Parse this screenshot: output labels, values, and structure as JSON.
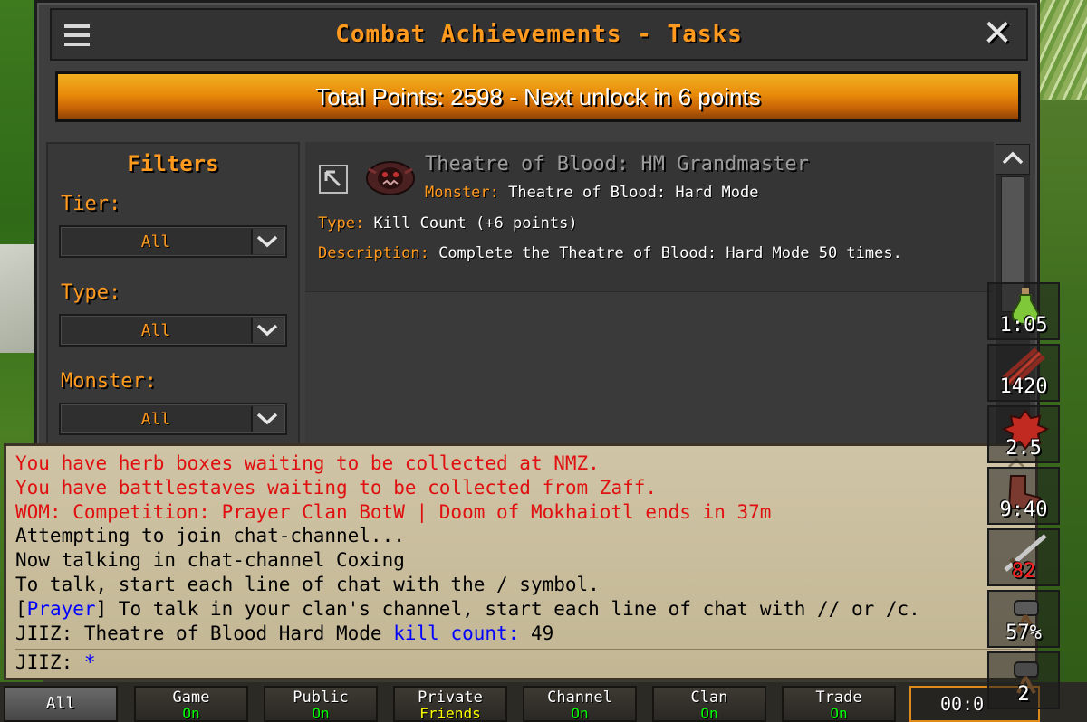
{
  "window": {
    "title": "Combat Achievements - Tasks",
    "total_points": "Total Points: 2598 - Next unlock in 6 points"
  },
  "filters": {
    "heading": "Filters",
    "items": [
      {
        "label": "Tier:",
        "value": "All"
      },
      {
        "label": "Type:",
        "value": "All"
      },
      {
        "label": "Monster:",
        "value": "All"
      }
    ]
  },
  "task": {
    "name": "Theatre of Blood: HM Grandmaster",
    "monster_key": "Monster:",
    "monster_value": "Theatre of Blood: Hard Mode",
    "type_key": "Type:",
    "type_value": "Kill Count (+6 points)",
    "description_key": "Description:",
    "description_value": "Complete the Theatre of Blood: Hard Mode 50 times."
  },
  "chat": {
    "lines": [
      {
        "text": "You have herb boxes waiting to be collected at NMZ.",
        "color": "#e01010"
      },
      {
        "text": "You have battlestaves waiting to be collected from Zaff.",
        "color": "#e01010"
      },
      {
        "text": "WOM: Competition: Prayer Clan BotW | Doom of Mokhaiotl ends in 37m",
        "color": "#e01010"
      },
      {
        "text": "Attempting to join chat-channel...",
        "color": "#000000"
      },
      {
        "text": "Now talking in chat-channel Coxing",
        "color": "#000000"
      },
      {
        "text": "To talk, start each line of chat with the / symbol.",
        "color": "#000000"
      }
    ],
    "clan_line": {
      "open": "[",
      "clan": "Prayer",
      "rest": "] To talk in your clan's channel, start each line of chat with // or /c."
    },
    "kc_line": {
      "prefix": "JIIZ: Theatre of Blood Hard Mode ",
      "kc_label": "kill count:",
      "kc_value": " 49"
    },
    "input": {
      "prefix": "JIIZ: ",
      "cursor": "*"
    }
  },
  "tabs": [
    {
      "label": "All",
      "status": "",
      "status_color": ""
    },
    {
      "label": "Game",
      "status": "On",
      "status_color": "#00ff00"
    },
    {
      "label": "Public",
      "status": "On",
      "status_color": "#00ff00"
    },
    {
      "label": "Private",
      "status": "Friends",
      "status_color": "#ffff00"
    },
    {
      "label": "Channel",
      "status": "On",
      "status_color": "#00ff00"
    },
    {
      "label": "Clan",
      "status": "On",
      "status_color": "#00ff00"
    },
    {
      "label": "Trade",
      "status": "On",
      "status_color": "#00ff00"
    }
  ],
  "timer": "00:0",
  "boosts": [
    {
      "icon": "potion-icon",
      "value": "1:05",
      "color": "#ffffff"
    },
    {
      "icon": "arrows-icon",
      "value": "1420",
      "color": "#ffffff"
    },
    {
      "icon": "spiked-shield-icon",
      "value": "2.5",
      "color": "#ffffff"
    },
    {
      "icon": "boots-icon",
      "value": "9:40",
      "color": "#ffffff"
    },
    {
      "icon": "sword-icon",
      "value": "82",
      "color": "#ff2020"
    },
    {
      "icon": "dwarf-cannon-icon",
      "value": "57%",
      "color": "#ffffff"
    },
    {
      "icon": "cannon-icon",
      "value": "2",
      "color": "#ffffff"
    }
  ]
}
